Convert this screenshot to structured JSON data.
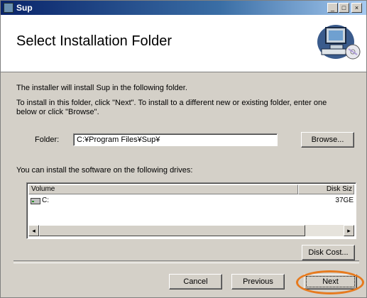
{
  "window": {
    "title": "Sup"
  },
  "titlebar_buttons": {
    "minimize": "_",
    "maximize": "□",
    "close": "×"
  },
  "header": {
    "title": "Select Installation Folder",
    "image_icon": "computer-cd-icon"
  },
  "intro": {
    "line1": "The installer will install Sup in the following folder.",
    "line2": "To install in this folder, click \"Next\". To install to a different new or existing folder, enter one",
    "line3": "below or click \"Browse\"."
  },
  "folder": {
    "label": "Folder:",
    "value": "C:¥Program Files¥Sup¥",
    "browse_label": "Browse..."
  },
  "drives": {
    "label": "You can install the software on the following drives:",
    "columns": [
      "Volume",
      "Disk Siz"
    ],
    "rows": [
      {
        "volume": "C:",
        "size": "37GE",
        "icon": "drive-icon"
      }
    ],
    "scroll_left": "◂",
    "scroll_right": "▸"
  },
  "disk_cost_label": "Disk Cost...",
  "footer": {
    "cancel_label": "Cancel",
    "previous_label": "Previous",
    "next_label": "Next"
  },
  "colors": {
    "title_bar": "#0a246a",
    "dialog_bg": "#d4d0c8",
    "highlight": "#e67a1e"
  }
}
